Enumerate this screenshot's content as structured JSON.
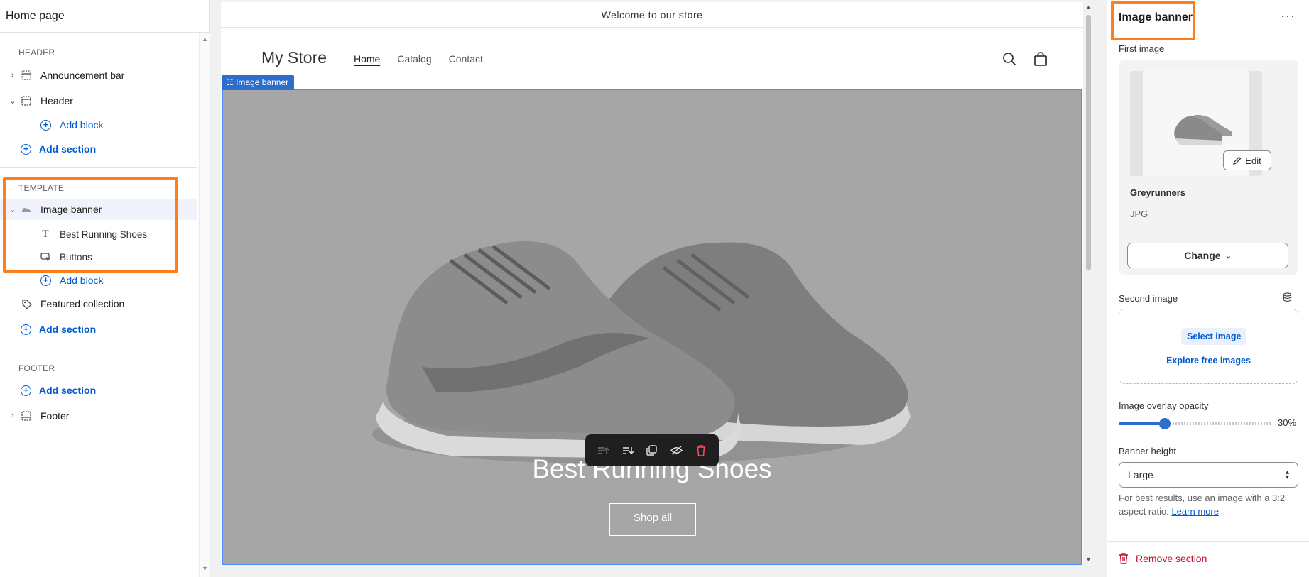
{
  "left": {
    "title": "Home page",
    "header_group": "HEADER",
    "announcement_bar": "Announcement bar",
    "header": "Header",
    "add_block": "Add block",
    "add_section": "Add section",
    "template_group": "TEMPLATE",
    "image_banner": "Image banner",
    "best_running_shoes": "Best Running Shoes",
    "buttons": "Buttons",
    "featured_collection": "Featured collection",
    "footer_group": "FOOTER",
    "footer": "Footer"
  },
  "preview": {
    "announcement": "Welcome to our store",
    "logo": "My Store",
    "nav": [
      "Home",
      "Catalog",
      "Contact"
    ],
    "section_tag": "Image banner",
    "banner_heading": "Best Running Shoes",
    "banner_button": "Shop all"
  },
  "right": {
    "title": "Image banner",
    "first_image_label": "First image",
    "image_name": "Greyrunners",
    "image_type": "JPG",
    "edit_label": "Edit",
    "change_label": "Change",
    "second_image_label": "Second image",
    "select_image": "Select image",
    "explore_images": "Explore free images",
    "overlay_label": "Image overlay opacity",
    "overlay_value": "30%",
    "overlay_fraction": 0.3,
    "banner_height_label": "Banner height",
    "banner_height_value": "Large",
    "help_text": "For best results, use an image with a 3:2 aspect ratio.",
    "learn_more": "Learn more",
    "remove_section": "Remove section"
  },
  "colors": {
    "accent": "#005bd3",
    "highlight": "#ff7d1a",
    "danger": "#c70a24",
    "banner_bg": "#a6a6a6"
  }
}
